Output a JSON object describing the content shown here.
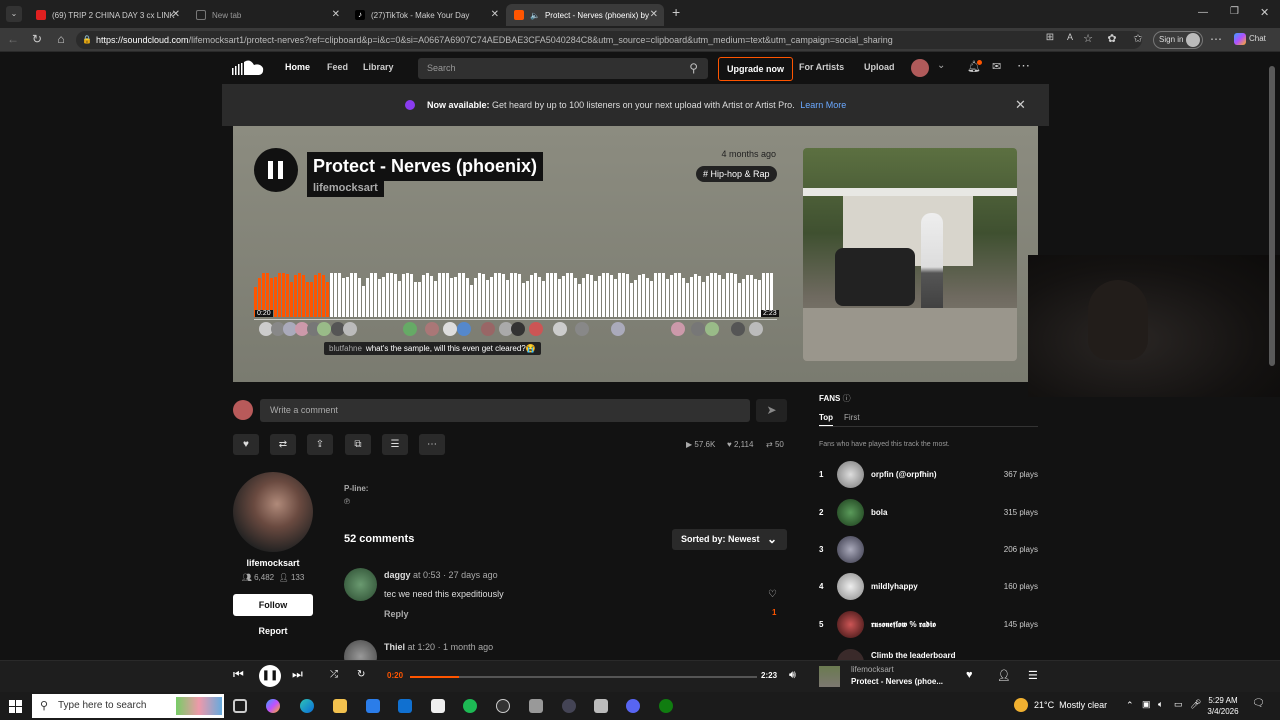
{
  "browser": {
    "tabs": [
      {
        "label": "(69) TRIP 2 CHINA DAY 3 cx LINK",
        "icon_color": "#e02020"
      },
      {
        "label": "New tab",
        "icon_color": "#555555"
      },
      {
        "label": "(27)TikTok - Make Your Day",
        "icon_color": "#000000"
      },
      {
        "label": "Protect - Nerves (phoenix) by",
        "icon_color": "#ff5500"
      }
    ],
    "new_tab": "+",
    "url_host": "https://soundcloud.com",
    "url_path": "/lifemocksart1/protect-nerves?ref=clipboard&p=i&c=0&si=A0667A6907C74AEDBAE3CFA5040284C8&utm_source=clipboard&utm_medium=text&utm_campaign=social_sharing",
    "sign_in": "Sign in",
    "chat": "Chat"
  },
  "nav": {
    "home": "Home",
    "feed": "Feed",
    "library": "Library",
    "search_placeholder": "Search",
    "upgrade": "Upgrade now",
    "for_artists": "For Artists",
    "upload": "Upload"
  },
  "banner": {
    "bold": "Now available:",
    "text": " Get heard by up to 100 listeners on your next upload with Artist or Artist Pro.",
    "link": "Learn More"
  },
  "track": {
    "title": "Protect - Nerves (phoenix)",
    "artist": "lifemocksart",
    "posted": "4 months ago",
    "genre": "# Hip-hop & Rap",
    "elapsed_label": "0:20",
    "duration_label": "2:23",
    "progress": 0.14,
    "tooltip_user": "blutfahne",
    "tooltip_text": "what's the sample, will this even get cleared?😭"
  },
  "comment_box": {
    "placeholder": "Write a comment"
  },
  "stats": {
    "plays": "57.6K",
    "likes": "2,114",
    "reposts": "50"
  },
  "profile": {
    "name": "lifemocksart",
    "followers": "6,482",
    "following": "133",
    "follow": "Follow",
    "report": "Report"
  },
  "info": {
    "pline": "P-line:",
    "pmark": "℗"
  },
  "comments": {
    "count": "52 comments",
    "sort": "Sorted by: Newest",
    "items": [
      {
        "user": "daggy",
        "at": " at ",
        "time": "0:53",
        "ago": " · 27 days ago",
        "text": "tec we need this expeditiously",
        "reply": "Reply",
        "likes": "1"
      },
      {
        "user": "Thiel",
        "at": " at ",
        "time": "1:20",
        "ago": " · 1 month ago",
        "text": "",
        "reply": "",
        "likes": ""
      }
    ]
  },
  "fans": {
    "heading": "FANS",
    "tab_top": "Top",
    "tab_first": "First",
    "desc": "Fans who have played this track the most.",
    "items": [
      {
        "rank": "1",
        "name": "orpfin (@orpfhin)",
        "plays": "367 plays"
      },
      {
        "rank": "2",
        "name": "bola",
        "plays": "315 plays"
      },
      {
        "rank": "3",
        "name": "",
        "plays": "206 plays"
      },
      {
        "rank": "4",
        "name": "mildlyhappy",
        "plays": "160 plays"
      },
      {
        "rank": "5",
        "name": "𝖗𝖚𝖘𝖔𝖓𝖊𝖋𝖑𝖔𝖜 % 𝖗𝖆𝖉𝖎𝖔",
        "plays": "145 plays"
      },
      {
        "rank": "",
        "name": "Climb the leaderboard",
        "plays": ""
      }
    ]
  },
  "player": {
    "elapsed": "0:20",
    "duration": "2:23",
    "artist": "lifemocksart",
    "title": "Protect - Nerves (phoe..."
  },
  "taskbar": {
    "search_placeholder": "Type here to search",
    "temp": "21°C",
    "weather": "Mostly clear",
    "time": "5:29 AM",
    "date": "3/4/2026"
  }
}
